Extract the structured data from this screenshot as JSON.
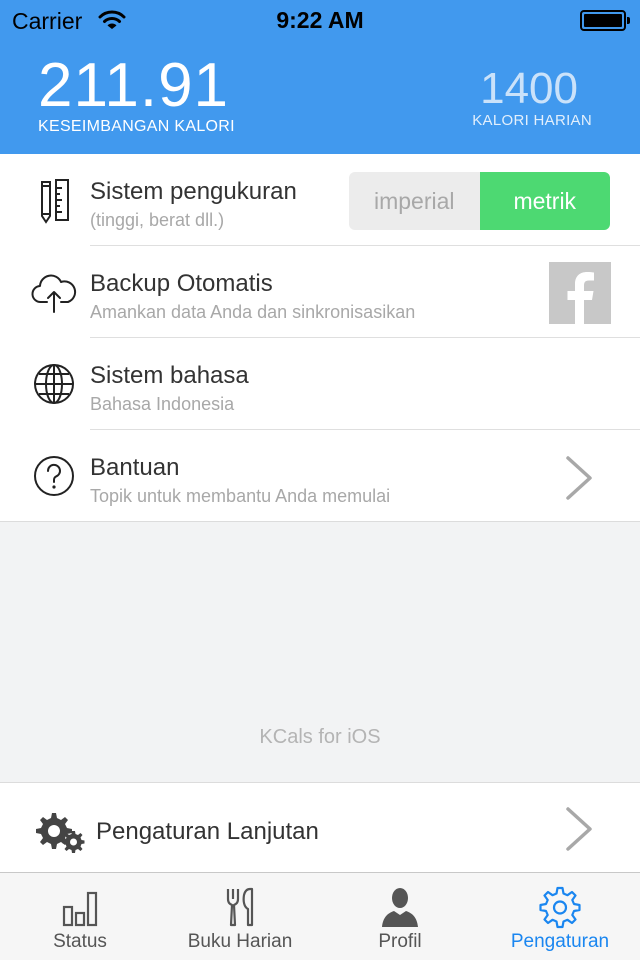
{
  "status_bar": {
    "carrier": "Carrier",
    "time": "9:22 AM"
  },
  "header": {
    "balance_value": "211.91",
    "balance_label": "KESEIMBANGAN KALORI",
    "daily_value": "1400",
    "daily_label": "KALORI HARIAN"
  },
  "settings": {
    "measurement": {
      "title": "Sistem pengukuran",
      "subtitle": "(tinggi, berat dll.)",
      "option_imperial": "imperial",
      "option_metric": "metrik",
      "selected": "metrik"
    },
    "backup": {
      "title": "Backup Otomatis",
      "subtitle": "Amankan data Anda dan sinkronisasikan",
      "icon": "facebook-icon"
    },
    "language": {
      "title": "Sistem bahasa",
      "subtitle": "Bahasa Indonesia"
    },
    "help": {
      "title": "Bantuan",
      "subtitle": "Topik untuk membantu Anda memulai"
    }
  },
  "footer_text": "KCals for iOS",
  "advanced": {
    "title": "Pengaturan Lanjutan"
  },
  "tabs": [
    {
      "label": "Status",
      "icon": "bar-chart-icon",
      "active": false
    },
    {
      "label": "Buku Harian",
      "icon": "fork-knife-icon",
      "active": false
    },
    {
      "label": "Profil",
      "icon": "person-icon",
      "active": false
    },
    {
      "label": "Pengaturan",
      "icon": "gear-icon",
      "active": true
    }
  ],
  "colors": {
    "header_blue": "#4199ee",
    "toggle_green": "#4dd972",
    "tab_active": "#1a86f0"
  }
}
